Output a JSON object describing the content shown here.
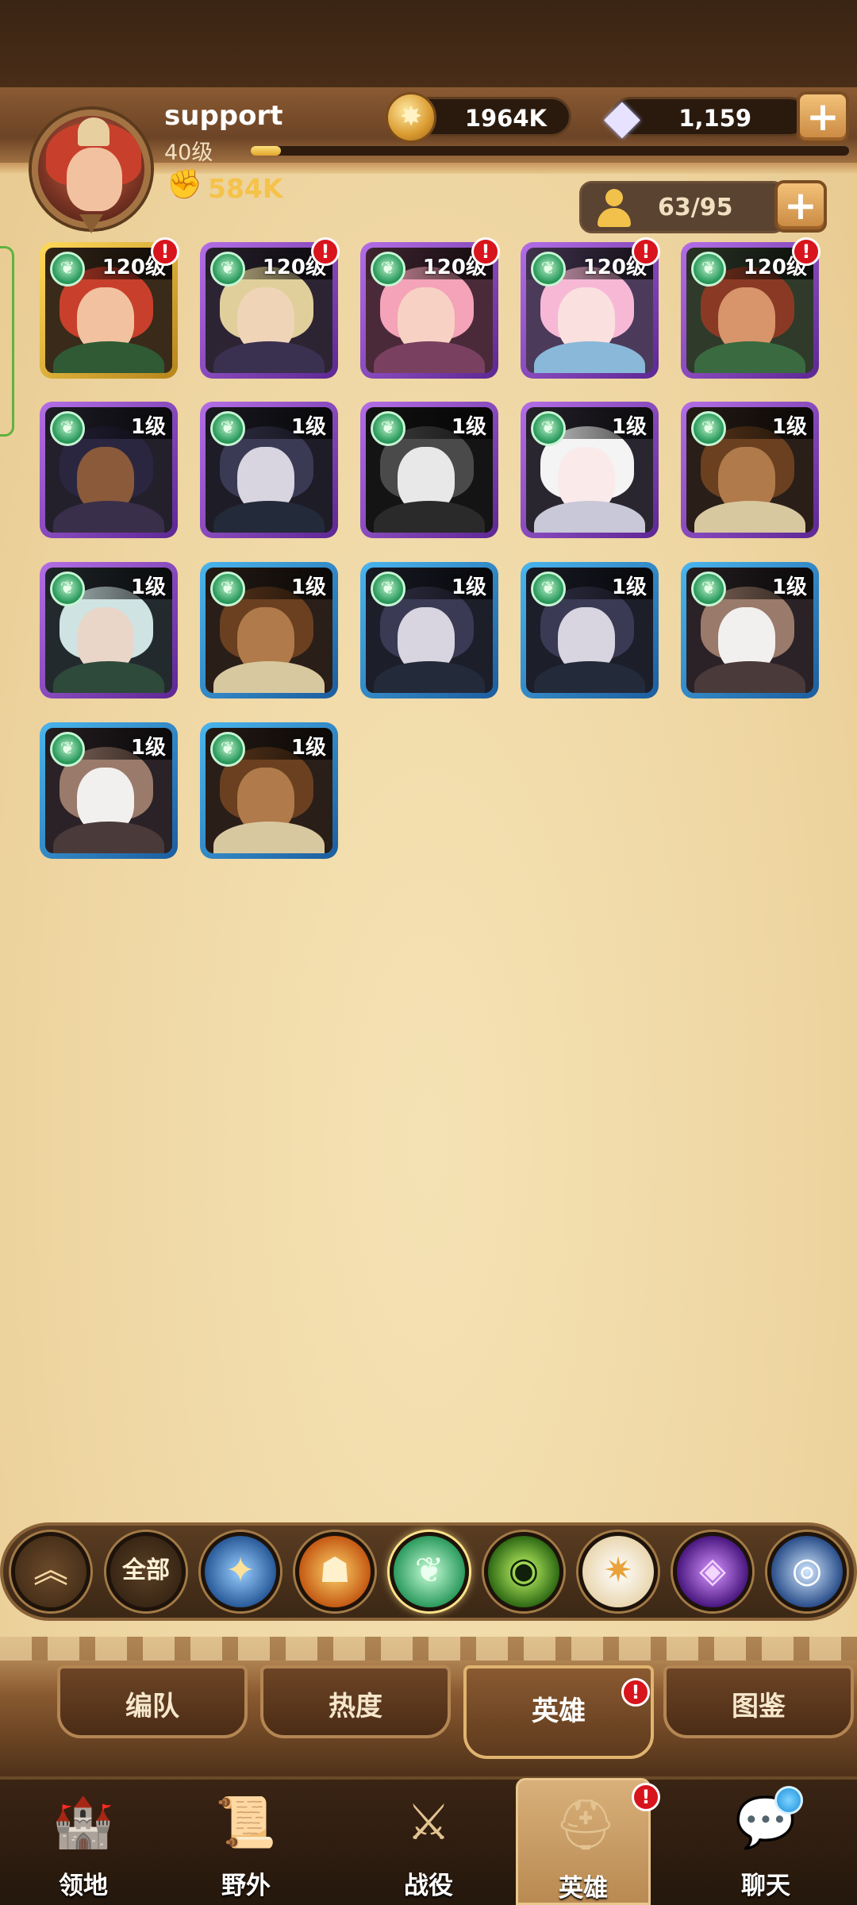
{
  "player": {
    "name": "support",
    "level": "40级",
    "xp_fraction": 0.05,
    "power": "584K"
  },
  "resources": {
    "gold": "1964K",
    "diamonds": "1,159"
  },
  "hero_slots": "63/95",
  "heroes": [
    {
      "level": "120级",
      "frame": "gold",
      "alert": "!"
    },
    {
      "level": "120级",
      "frame": "purple",
      "alert": "!"
    },
    {
      "level": "120级",
      "frame": "purple",
      "alert": "!"
    },
    {
      "level": "120级",
      "frame": "purple",
      "alert": "!"
    },
    {
      "level": "120级",
      "frame": "purple",
      "alert": "!"
    },
    {
      "level": "1级",
      "frame": "purple"
    },
    {
      "level": "1级",
      "frame": "purple"
    },
    {
      "level": "1级",
      "frame": "purple"
    },
    {
      "level": "1级",
      "frame": "purple"
    },
    {
      "level": "1级",
      "frame": "purple"
    },
    {
      "level": "1级",
      "frame": "purple"
    },
    {
      "level": "1级",
      "frame": "blue"
    },
    {
      "level": "1级",
      "frame": "blue"
    },
    {
      "level": "1级",
      "frame": "blue"
    },
    {
      "level": "1级",
      "frame": "blue"
    },
    {
      "level": "1级",
      "frame": "blue"
    },
    {
      "level": "1级",
      "frame": "blue"
    }
  ],
  "filters": {
    "all_label": "全部",
    "items": [
      "collapse-up",
      "all",
      "lightbearer",
      "mauler",
      "wilder",
      "graveborn",
      "celestial",
      "hypogean",
      "dimensional"
    ],
    "selected": "wilder"
  },
  "subtabs": [
    {
      "label": "编队"
    },
    {
      "label": "热度"
    },
    {
      "label": "英雄",
      "active": true,
      "alert": "!"
    },
    {
      "label": "图鉴"
    }
  ],
  "nav": [
    {
      "label": "领地",
      "icon": "castle-icon"
    },
    {
      "label": "野外",
      "icon": "scroll-map-icon"
    },
    {
      "label": "战役",
      "icon": "crossed-swords-icon"
    },
    {
      "label": "英雄",
      "icon": "helmet-icon",
      "active": true,
      "alert": "!"
    },
    {
      "label": "聊天",
      "icon": "chat-icon",
      "notification": true
    }
  ],
  "colors": {
    "gold_frame": "#ffd95a",
    "purple_frame": "#8a49c4",
    "blue_frame": "#2f8fd3",
    "alert": "#d8141c",
    "background": "#f0d9a8"
  }
}
